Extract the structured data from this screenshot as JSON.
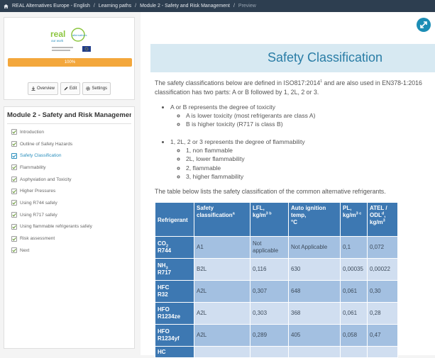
{
  "breadcrumb": {
    "items": [
      "REAL Alternatives Europe - English",
      "Learning paths",
      "Module 2 - Safety and Risk Management"
    ],
    "current": "Preview",
    "separator": "/"
  },
  "sidebar": {
    "logo": {
      "line1": "real",
      "line2": "alternatives",
      "tagline": "our work"
    },
    "progress": {
      "value": 1.0,
      "label": "100%"
    },
    "buttons": {
      "overview": "Overview",
      "edit": "Edit",
      "settings": "Settings"
    },
    "module_title": "Module 2 - Safety and Risk Management",
    "items": [
      {
        "label": "Introduction",
        "active": false
      },
      {
        "label": "Outline of Safety Hazards",
        "active": false
      },
      {
        "label": "Safety Classification",
        "active": true
      },
      {
        "label": "Flammability",
        "active": false
      },
      {
        "label": "Asphyxiation and Toxicity",
        "active": false
      },
      {
        "label": "Higher Pressures",
        "active": false
      },
      {
        "label": "Using R744 safely",
        "active": false
      },
      {
        "label": "Using R717 safely",
        "active": false
      },
      {
        "label": "Using flammable refrigerants safely",
        "active": false
      },
      {
        "label": "Risk assessment",
        "active": false
      },
      {
        "label": "Next",
        "active": false
      }
    ]
  },
  "content": {
    "title": "Safety Classification",
    "intro": {
      "part1": "The safety classifications below are defined in ISO817:2014",
      "sup": "1",
      "part2": " and are also used in EN378-1:2016",
      "line2": "classification has two parts: A or B followed by 1, 2L, 2 or 3."
    },
    "toxicity": {
      "main": "A or B represents the degree of toxicity",
      "a": "A is lower toxicity (most refrigerants are class A)",
      "b": "B is higher toxicity (R717 is class B)"
    },
    "flammability": {
      "main": "1, 2L, 2 or 3 represents the degree of flammability",
      "c1": "1, non flammable",
      "c2": "2L, lower flammability",
      "c3": "2, flammable",
      "c4": "3, higher flammability"
    },
    "table_intro": "The table below lists the safety classification of the common alternative refrigerants."
  },
  "table": {
    "headers": {
      "refrigerant": "Refrigerant",
      "safety_line1": "Safety",
      "safety_line2": "classification",
      "safety_sup": "a",
      "lfl_line1": "LFL,",
      "lfl_line2": "kg/m",
      "lfl_sup": "3 b",
      "ait_line1": "Auto ignition",
      "ait_line2": "temp,",
      "ait_line3": "°C",
      "pl_line1": "PL,",
      "pl_line2": "kg/m",
      "pl_sup": "3 c",
      "atel_line1": "ATEL /",
      "atel_line2": "ODL",
      "atel_sup": "d",
      "atel_line2b": ",",
      "atel_line3": "kg/m",
      "atel_sup3": "3"
    },
    "rows": [
      {
        "name_pre": "CO",
        "name_sub": "2",
        "code": "R744",
        "safety": "A1",
        "lfl": "Not applicable",
        "ait": "Not Applicable",
        "pl": "0,1",
        "atel": "0,072"
      },
      {
        "name_pre": "NH",
        "name_sub": "3",
        "code": "R717",
        "safety": "B2L",
        "lfl": "0,116",
        "ait": "630",
        "pl": "0,00035",
        "atel": "0,00022"
      },
      {
        "name_pre": "HFC",
        "name_sub": "",
        "code": "R32",
        "safety": "A2L",
        "lfl": "0,307",
        "ait": "648",
        "pl": "0,061",
        "atel": "0,30"
      },
      {
        "name_pre": "HFO",
        "name_sub": "",
        "code": "R1234ze",
        "safety": "A2L",
        "lfl": "0,303",
        "ait": "368",
        "pl": "0,061",
        "atel": "0,28"
      },
      {
        "name_pre": "HFO",
        "name_sub": "",
        "code": "R1234yf",
        "safety": "A2L",
        "lfl": "0,289",
        "ait": "405",
        "pl": "0,058",
        "atel": "0,47"
      },
      {
        "name_pre": "HC",
        "name_sub": "",
        "code": "",
        "safety": "",
        "lfl": "",
        "ait": "",
        "pl": "",
        "atel": ""
      }
    ]
  },
  "colors": {
    "topbar": "#2d3e50",
    "progress": "#f3a73c",
    "accent": "#2a8fbd",
    "table_header": "#3d78b2",
    "row_odd": "#a3c0e1",
    "row_even": "#d0def0",
    "title_band": "#d7e9f2"
  },
  "icons": {
    "home": "home-icon",
    "overview": "download-icon",
    "edit": "pencil-icon",
    "settings": "gear-icon",
    "check": "check-icon",
    "expand": "expand-icon"
  }
}
